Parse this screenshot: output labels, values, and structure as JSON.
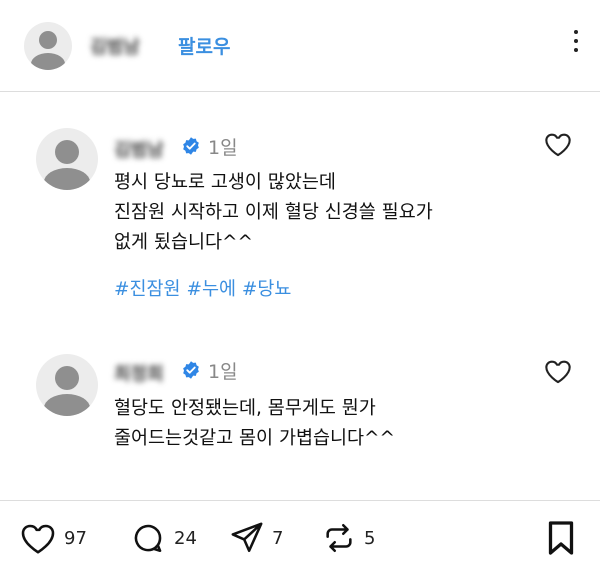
{
  "header": {
    "username": "김범남",
    "follow_label": "팔로우",
    "more_icon": "more-vertical-icon"
  },
  "posts": [
    {
      "username": "김범남",
      "time": "1일",
      "verified": true,
      "lines": [
        "평시 당뇨로 고생이 많았는데",
        "진잠원 시작하고 이제 혈당 신경쓸 필요가",
        "없게 됬습니다^^"
      ],
      "tags": [
        "#진잠원",
        "#누에",
        "#당뇨"
      ]
    },
    {
      "username": "최정희",
      "time": "1일",
      "verified": true,
      "lines": [
        "혈당도 안정됐는데, 몸무게도 뭔가",
        "줄어드는것같고 몸이 가볍습니다^^"
      ]
    }
  ],
  "actions": {
    "likes": "97",
    "comments": "24",
    "reposts": "7",
    "shares": "5"
  },
  "colors": {
    "accent": "#3b8fe0",
    "verified": "#2f86e6"
  }
}
